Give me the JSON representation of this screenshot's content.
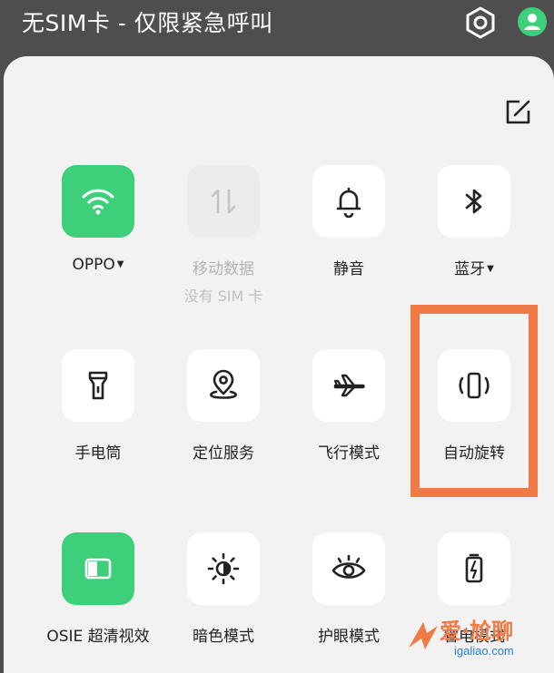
{
  "status_bar": {
    "carrier_text": "无SIM卡 - 仅限紧急呼叫",
    "settings_icon": "gear-icon",
    "account_icon": "avatar-icon"
  },
  "panel": {
    "edit_icon": "edit-icon"
  },
  "tiles": [
    {
      "label": "OPPO",
      "has_caret": true,
      "state": "on",
      "icon": "wifi-icon"
    },
    {
      "label": "移动数据",
      "sublabel": "没有 SIM 卡",
      "state": "disabled",
      "icon": "data-arrows-icon"
    },
    {
      "label": "静音",
      "state": "off",
      "icon": "bell-icon"
    },
    {
      "label": "蓝牙",
      "has_caret": true,
      "state": "off",
      "icon": "bluetooth-icon"
    },
    {
      "label": "手电筒",
      "state": "off",
      "icon": "flashlight-icon"
    },
    {
      "label": "定位服务",
      "state": "off",
      "icon": "location-icon"
    },
    {
      "label": "飞行模式",
      "state": "off",
      "icon": "airplane-icon"
    },
    {
      "label": "自动旋转",
      "state": "off",
      "icon": "auto-rotate-icon",
      "highlighted": true
    },
    {
      "label": "OSIE 超清视效",
      "state": "on",
      "icon": "osie-icon"
    },
    {
      "label": "暗色模式",
      "state": "off",
      "icon": "dark-mode-icon"
    },
    {
      "label": "护眼模式",
      "state": "off",
      "icon": "eye-icon"
    },
    {
      "label": "省电模式",
      "state": "off",
      "icon": "battery-saver-icon"
    }
  ],
  "highlight_color": "#f07a45",
  "accent_color": "#3ecf7a",
  "watermark": {
    "text": "爱·尬聊",
    "url": "igaliao.com"
  }
}
